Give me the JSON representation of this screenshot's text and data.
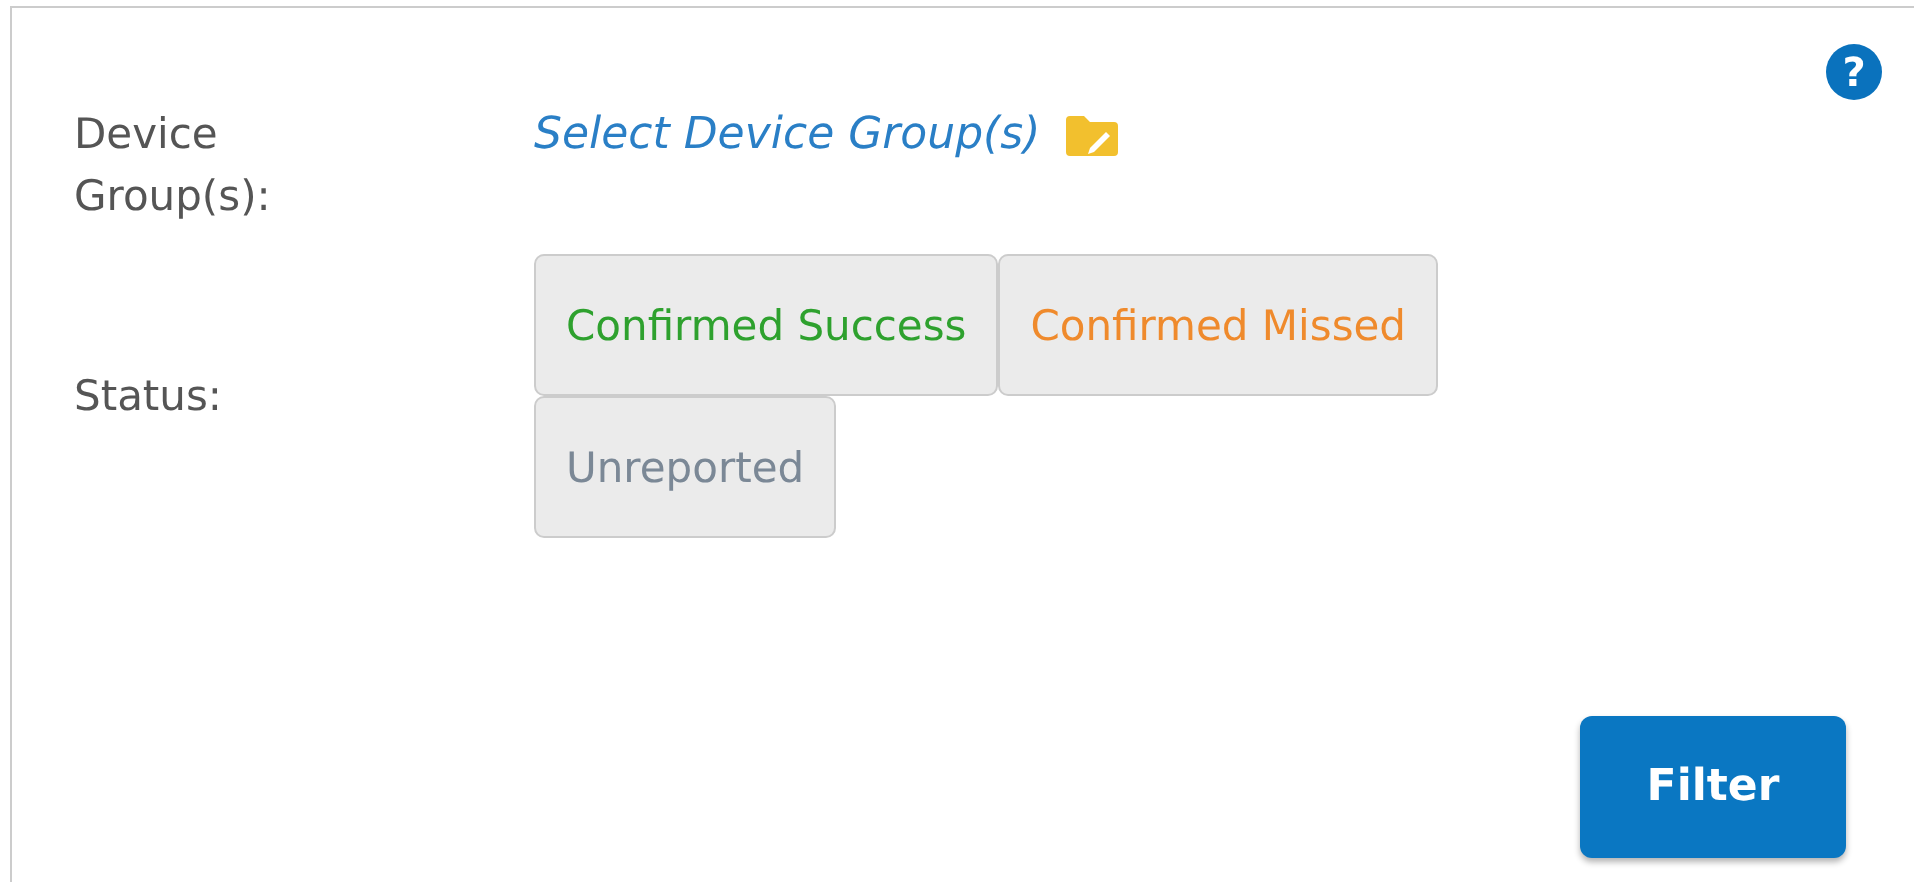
{
  "help": "?",
  "device_groups": {
    "label": "Device Group(s):",
    "link": "Select Device Group(s)"
  },
  "status": {
    "label": "Status:",
    "options": [
      {
        "label": "Confirmed Success",
        "color": "#2ea12e",
        "selected": false
      },
      {
        "label": "Confirmed Missed",
        "color": "#ef8a2c",
        "selected": false
      },
      {
        "label": "Unreported",
        "color": "#7b8896",
        "selected": false
      }
    ]
  },
  "filter_button": "Filter"
}
